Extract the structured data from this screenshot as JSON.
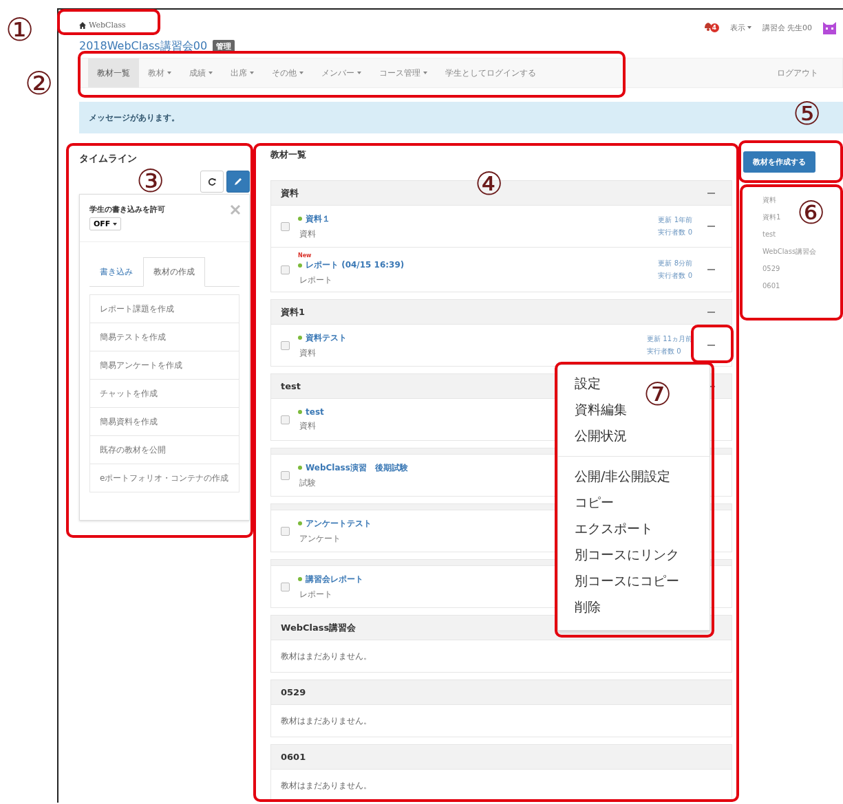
{
  "header": {
    "breadcrumb": "WebClass",
    "course_title": "2018WebClass講習会00",
    "role_badge": "管理",
    "notification_count": "4",
    "view_menu": "表示",
    "user": "講習会 先生00"
  },
  "nav": {
    "items": [
      {
        "label": "教材一覧",
        "dropdown": false,
        "selected": true
      },
      {
        "label": "教材",
        "dropdown": true,
        "selected": false
      },
      {
        "label": "成績",
        "dropdown": true,
        "selected": false
      },
      {
        "label": "出席",
        "dropdown": true,
        "selected": false
      },
      {
        "label": "その他",
        "dropdown": true,
        "selected": false
      },
      {
        "label": "メンバー",
        "dropdown": true,
        "selected": false
      },
      {
        "label": "コース管理",
        "dropdown": true,
        "selected": false
      },
      {
        "label": "学生としてログインする",
        "dropdown": false,
        "selected": false
      }
    ],
    "logout": "ログアウト"
  },
  "alert": "メッセージがあります。",
  "timeline": {
    "title": "タイムライン",
    "setting_label": "学生の書き込みを許可",
    "setting_value": "OFF",
    "tabs": [
      {
        "label": "書き込み",
        "selected": false
      },
      {
        "label": "教材の作成",
        "selected": true
      }
    ],
    "actions": [
      "レポート課題を作成",
      "簡易テストを作成",
      "簡易アンケートを作成",
      "チャットを作成",
      "簡易資料を作成",
      "既存の教材を公開",
      "eポートフォリオ・コンテナの作成"
    ]
  },
  "materials": {
    "title": "教材一覧",
    "sections": [
      {
        "title": "資料",
        "items": [
          {
            "name": "資料１",
            "type": "資料",
            "checked": false,
            "updated": "更新 1年前",
            "runs": "実行者数 0"
          },
          {
            "name": "レポート (04/15 16:39)",
            "new_label": "New",
            "type": "レポート",
            "checked": false,
            "updated": "更新 8分前",
            "runs": "実行者数 0"
          }
        ]
      },
      {
        "title": "資料1",
        "items": [
          {
            "name": "資料テスト",
            "type": "資料",
            "checked": false,
            "updated": "更新 11ヵ月前",
            "runs": "実行者数 0"
          }
        ]
      },
      {
        "title": "test",
        "items": [
          {
            "name": "test",
            "type": "資料",
            "checked": false
          }
        ]
      },
      {
        "items": [
          {
            "name": "WebClass演習　後期試験",
            "type": "試験",
            "checked": false
          }
        ]
      },
      {
        "items": [
          {
            "name": "アンケートテスト",
            "type": "アンケート",
            "checked": false
          }
        ]
      },
      {
        "items": [
          {
            "name": "講習会レポート",
            "type": "レポート",
            "checked": false
          }
        ]
      },
      {
        "title": "WebClass講習会",
        "empty_text": "教材はまだありません。"
      },
      {
        "title": "0529",
        "empty_text": "教材はまだありません。"
      },
      {
        "title": "0601",
        "empty_text": "教材はまだありません。"
      }
    ]
  },
  "context_menu": {
    "groups": [
      [
        "設定",
        "資料編集",
        "公開状況"
      ],
      [
        "公開/非公開設定",
        "コピー",
        "エクスポート",
        "別コースにリンク",
        "別コースにコピー",
        "削除"
      ]
    ]
  },
  "sidebar": {
    "create_button": "教材を作成する",
    "sections": [
      "資料",
      "資料1",
      "test",
      "WebClass講習会",
      "0529",
      "0601"
    ]
  },
  "annotations": [
    {
      "label": "①"
    },
    {
      "label": "②"
    },
    {
      "label": "③"
    },
    {
      "label": "④"
    },
    {
      "label": "⑤"
    },
    {
      "label": "⑥"
    },
    {
      "label": "⑦"
    }
  ]
}
